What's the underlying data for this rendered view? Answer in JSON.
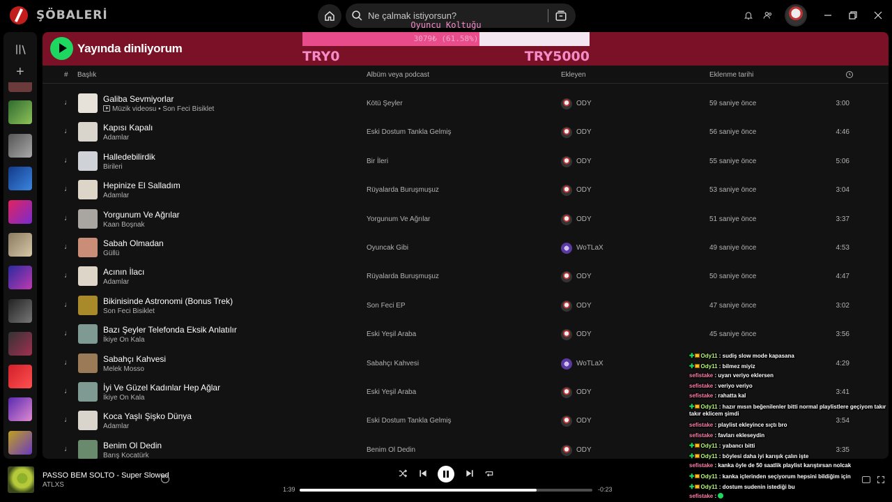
{
  "topbar": {
    "brand": "ŞÖBALERİ",
    "search_placeholder": "Ne çalmak istiyorsun?"
  },
  "header": {
    "title": "Yayında dinliyorum"
  },
  "goal": {
    "title": "Oyuncu Koltuğu",
    "progress_text": "3079₺ (61.58%)",
    "fraction": 0.6158,
    "min_label": "TRY0",
    "max_label": "TRY5000"
  },
  "columns": {
    "number": "#",
    "title": "Başlık",
    "album": "Albüm veya podcast",
    "added_by": "Ekleyen",
    "added_at": "Eklenme tarihi"
  },
  "tracks": [
    {
      "title": "Galiba Sevmiyorlar",
      "badge": "Müzik videosu",
      "artist": "Son Feci Bisiklet",
      "album": "Kötü Şeyler",
      "added_by": "ODY",
      "added_at": "59 saniye önce",
      "duration": "3:00",
      "cover": "#e6e2da"
    },
    {
      "title": "Kapısı Kapalı",
      "artist": "Adamlar",
      "album": "Eski Dostum Tankla Gelmiş",
      "added_by": "ODY",
      "added_at": "56 saniye önce",
      "duration": "4:46",
      "cover": "#d9d5cc"
    },
    {
      "title": "Halledebilirdik",
      "artist": "Birileri",
      "album": "Bir İleri",
      "added_by": "ODY",
      "added_at": "55 saniye önce",
      "duration": "5:06",
      "cover": "#cfd3d8"
    },
    {
      "title": "Hepinize El Salladım",
      "artist": "Adamlar",
      "album": "Rüyalarda Buruşmuşuz",
      "added_by": "ODY",
      "added_at": "53 saniye önce",
      "duration": "3:04",
      "cover": "#ddd6c8"
    },
    {
      "title": "Yorgunum Ve Ağrılar",
      "artist": "Kaan Boşnak",
      "album": "Yorgunum Ve Ağrılar",
      "added_by": "ODY",
      "added_at": "51 saniye önce",
      "duration": "3:37",
      "cover": "#a9a6a2"
    },
    {
      "title": "Sabah Olmadan",
      "artist": "Güllü",
      "album": "Oyuncak Gibi",
      "added_by": "WoTLaX",
      "added_at": "49 saniye önce",
      "duration": "4:53",
      "cover": "#c98d78"
    },
    {
      "title": "Acının İlacı",
      "artist": "Adamlar",
      "album": "Rüyalarda Buruşmuşuz",
      "added_by": "ODY",
      "added_at": "50 saniye önce",
      "duration": "4:47",
      "cover": "#ddd6c8"
    },
    {
      "title": "Bikinisinde Astronomi (Bonus Trek)",
      "artist": "Son Feci Bisiklet",
      "album": "Son Feci EP",
      "added_by": "ODY",
      "added_at": "47 saniye önce",
      "duration": "3:02",
      "cover": "#a88a2a"
    },
    {
      "title": "Bazı Şeyler Telefonda Eksik Anlatılır",
      "artist": "İkiye On Kala",
      "album": "Eski Yeşil Araba",
      "added_by": "ODY",
      "added_at": "45 saniye önce",
      "duration": "3:56",
      "cover": "#7e9a92"
    },
    {
      "title": "Sabahçı Kahvesi",
      "artist": "Melek Mosso",
      "album": "Sabahçı Kahvesi",
      "added_by": "WoTLaX",
      "added_at": "",
      "duration": "4:29",
      "cover": "#9b7a58"
    },
    {
      "title": "İyi Ve Güzel Kadınlar Hep Ağlar",
      "artist": "İkiye On Kala",
      "album": "Eski Yeşil Araba",
      "added_by": "ODY",
      "added_at": "",
      "duration": "3:41",
      "cover": "#7e9a92"
    },
    {
      "title": "Koca Yaşlı Şişko Dünya",
      "artist": "Adamlar",
      "album": "Eski Dostum Tankla Gelmiş",
      "added_by": "ODY",
      "added_at": "",
      "duration": "3:54",
      "cover": "#d9d5cc"
    },
    {
      "title": "Benim Ol Dedin",
      "artist": "Barış Kocatürk",
      "album": "Benim Ol Dedin",
      "added_by": "ODY",
      "added_at": "",
      "duration": "3:35",
      "cover": "#6a8a6e"
    }
  ],
  "player": {
    "title": "PASSO BEM SOLTO - Super Slowed",
    "artist": "ATLXS",
    "elapsed": "1:39",
    "remaining": "-0:23",
    "progress_fraction": 0.81
  },
  "chat": [
    {
      "user": "Ody11",
      "text": ": sudiş slow mode kapasana",
      "color": "green",
      "badges": true
    },
    {
      "user": "Ody11",
      "text": ": bilmez miyiz",
      "color": "green",
      "badges": true
    },
    {
      "user": "sefistake",
      "text": ": uyarı veriyo eklersen",
      "color": "pink",
      "badges": false
    },
    {
      "user": "sefistake",
      "text": ": veriyo veriyo",
      "color": "pink",
      "badges": false
    },
    {
      "user": "sefistake",
      "text": ": rahatta kal",
      "color": "pink",
      "badges": false
    },
    {
      "user": "Ody11",
      "text": ": hazır mısın beğenilenler bitti normal playlistlere geçiyom takır takır eklicem şimdi",
      "color": "green",
      "badges": true
    },
    {
      "user": "sefistake",
      "text": ": playlist ekleyince sıçtı bro",
      "color": "pink",
      "badges": false
    },
    {
      "user": "sefistake",
      "text": ": favları ekleseydin",
      "color": "pink",
      "badges": false
    },
    {
      "user": "Ody11",
      "text": ": yabancı bitti",
      "color": "green",
      "badges": true
    },
    {
      "user": "Ody11",
      "text": ": böylesi daha iyi karışık çalın işte",
      "color": "green",
      "badges": true
    },
    {
      "user": "sefistake",
      "text": ": kanka öyle de 50 saatlik playlist karıştırsan nolcak",
      "color": "pink",
      "badges": false
    },
    {
      "user": "Ody11",
      "text": ": kanka içlerinden seçiyorum hepsini bildiğim için",
      "color": "green",
      "badges": true
    },
    {
      "user": "Ody11",
      "text": ": dostum sudenin istediği bu",
      "color": "green",
      "badges": true
    },
    {
      "user": "sefistake",
      "text": ":",
      "color": "pink",
      "badges": false,
      "emote": true
    }
  ]
}
